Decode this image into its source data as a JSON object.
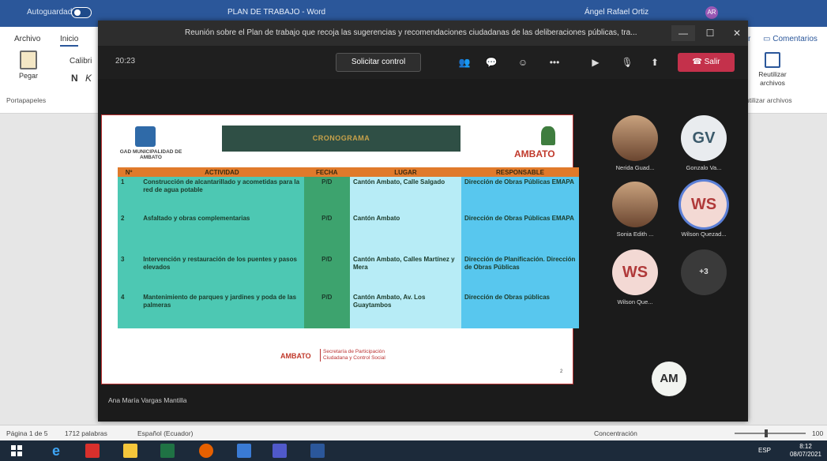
{
  "word": {
    "autosave_label": "Autoguardado",
    "title": "PLAN DE TRABAJO - Word",
    "user": "Ángel Rafael Ortiz",
    "tabs": [
      "Archivo",
      "Inicio"
    ],
    "paste_label": "Pegar",
    "font_name": "Calibri",
    "bold_label": "N",
    "italic_label": "K",
    "clipboard_group": "Portapapeles",
    "comments_label": "Comentarios",
    "r_label": "r",
    "reuse_label": "Reutilizar archivos",
    "reuse_group": "utilizar archivos",
    "status": {
      "page": "Página 1 de 5",
      "words": "1712 palabras",
      "language": "Español (Ecuador)",
      "focus": "Concentración",
      "zoom_end": "100"
    }
  },
  "teams": {
    "title": "Reunión sobre el Plan de trabajo que recoja las sugerencias y recomendaciones ciudadanas de las deliberaciones públicas, tra...",
    "timer": "20:23",
    "request_control": "Solicitar control",
    "leave": "Salir",
    "presenter": "Ana María Vargas Mantilla",
    "participants": [
      {
        "name": "Nerida Guad...",
        "initials": ""
      },
      {
        "name": "Gonzalo Va...",
        "initials": "GV"
      },
      {
        "name": "Sonia Edith ...",
        "initials": ""
      },
      {
        "name": "Wilson Quezad...",
        "initials": "WS"
      },
      {
        "name": "Wilson Que...",
        "initials": "WS"
      },
      {
        "name": "",
        "initials": "+3"
      }
    ],
    "self_initials": "AM"
  },
  "slide": {
    "org": "GAD MUNICIPALIDAD DE AMBATO",
    "title": "CRONOGRAMA",
    "brand": "AMBATO",
    "headers": [
      "Nº",
      "ACTIVIDAD",
      "FECHA",
      "LUGAR",
      "RESPONSABLE"
    ],
    "rows": [
      {
        "n": "1",
        "actividad": "Construcción de alcantarillado y acometidas para la red de agua potable",
        "fecha": "P/D",
        "lugar": "Cantón Ambato, Calle Salgado",
        "responsable": "Dirección de Obras Públicas EMAPA"
      },
      {
        "n": "2",
        "actividad": "Asfaltado y obras complementarias",
        "fecha": "P/D",
        "lugar": "Cantón Ambato",
        "responsable": "Dirección de Obras Públicas EMAPA"
      },
      {
        "n": "3",
        "actividad": "Intervención y restauración de los puentes y pasos elevados",
        "fecha": "P/D",
        "lugar": "Cantón Ambato, Calles Martínez y Mera",
        "responsable": "Dirección de Planificación. Dirección de Obras Públicas"
      },
      {
        "n": "4",
        "actividad": "Mantenimiento de parques y jardines y poda de las palmeras",
        "fecha": "P/D",
        "lugar": "Cantón Ambato, Av. Los Guaytambos",
        "responsable": "Dirección de Obras públicas"
      }
    ],
    "footer_brand": "AMBATO",
    "footer_sec": "Secretaría de Participación Ciudadana y Control Social",
    "page": "2"
  },
  "taskbar": {
    "lang": "ESP",
    "time": "8:12",
    "date": "08/07/2021"
  }
}
